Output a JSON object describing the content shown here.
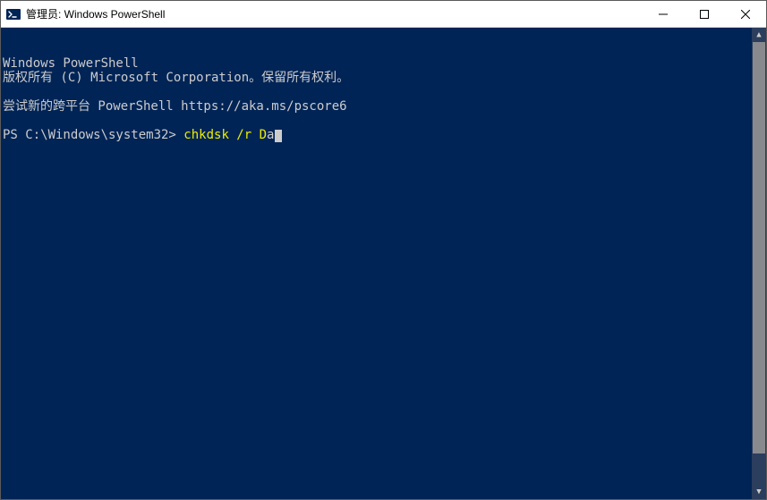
{
  "window": {
    "title": "管理员: Windows PowerShell"
  },
  "terminal": {
    "line1": "Windows PowerShell",
    "line2": "版权所有 (C) Microsoft Corporation。保留所有权利。",
    "line3": "",
    "line4": "尝试新的跨平台 PowerShell https://aka.ms/pscore6",
    "line5": "",
    "prompt": "PS C:\\Windows\\system32> ",
    "command": "chkdsk /r D",
    "command_tail": "a"
  },
  "colors": {
    "terminal_bg": "#012456",
    "terminal_fg": "#cccccc",
    "command_highlight": "#eeee00"
  }
}
